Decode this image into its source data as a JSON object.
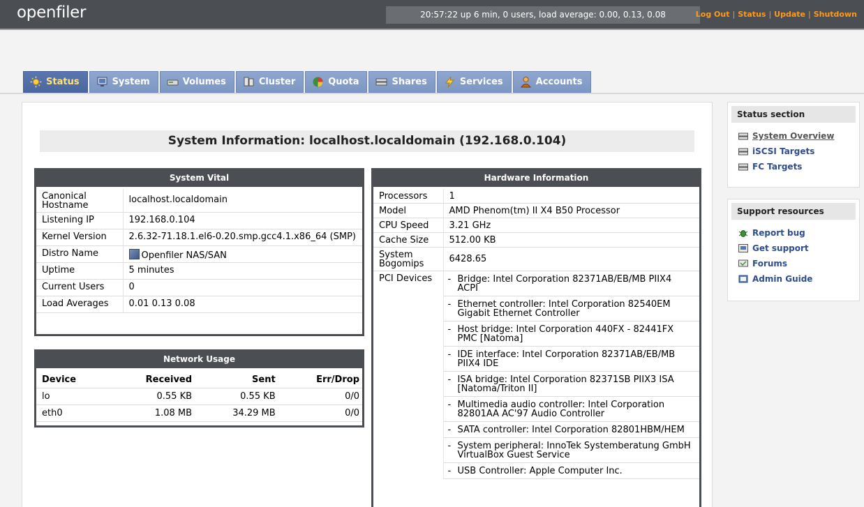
{
  "header": {
    "logo": "openfiler",
    "uptime": "20:57:22 up 6 min, 0 users, load average: 0.00, 0.13, 0.08",
    "links": [
      "Log Out",
      "Status",
      "Update",
      "Shutdown"
    ]
  },
  "tabs": [
    {
      "label": "Status",
      "icon": "sun-icon",
      "active": true
    },
    {
      "label": "System",
      "icon": "monitor-icon"
    },
    {
      "label": "Volumes",
      "icon": "disk-icon"
    },
    {
      "label": "Cluster",
      "icon": "cluster-icon"
    },
    {
      "label": "Quota",
      "icon": "pie-chart-icon"
    },
    {
      "label": "Shares",
      "icon": "server-icon"
    },
    {
      "label": "Services",
      "icon": "lightning-icon"
    },
    {
      "label": "Accounts",
      "icon": "user-icon"
    }
  ],
  "title": "System Information: localhost.localdomain (192.168.0.104)",
  "vital": {
    "heading": "System Vital",
    "rows": [
      {
        "k": "Canonical Hostname",
        "v": "localhost.localdomain"
      },
      {
        "k": "Listening IP",
        "v": "192.168.0.104"
      },
      {
        "k": "Kernel Version",
        "v": "2.6.32-71.18.1.el6-0.20.smp.gcc4.1.x86_64 (SMP)"
      },
      {
        "k": "Distro Name",
        "v": "Openfiler NAS/SAN"
      },
      {
        "k": "Uptime",
        "v": "5 minutes"
      },
      {
        "k": "Current Users",
        "v": "0"
      },
      {
        "k": "Load Averages",
        "v": "0.01 0.13 0.08"
      }
    ]
  },
  "network": {
    "heading": "Network Usage",
    "columns": [
      "Device",
      "Received",
      "Sent",
      "Err/Drop"
    ],
    "rows": [
      [
        "lo",
        "0.55 KB",
        "0.55 KB",
        "0/0"
      ],
      [
        "eth0",
        "1.08 MB",
        "34.29 MB",
        "0/0"
      ]
    ]
  },
  "hardware": {
    "heading": "Hardware Information",
    "rows": [
      {
        "k": "Processors",
        "v": "1"
      },
      {
        "k": "Model",
        "v": "AMD Phenom(tm) II X4 B50 Processor"
      },
      {
        "k": "CPU Speed",
        "v": "3.21 GHz"
      },
      {
        "k": "Cache Size",
        "v": "512.00 KB"
      },
      {
        "k": "System Bogomips",
        "v": "6428.65"
      }
    ],
    "pci_label": "PCI Devices",
    "pci": [
      "Bridge: Intel Corporation 82371AB/EB/MB PIIX4 ACPI",
      "Ethernet controller: Intel Corporation 82540EM Gigabit Ethernet Controller",
      "Host bridge: Intel Corporation 440FX - 82441FX PMC [Natoma]",
      "IDE interface: Intel Corporation 82371AB/EB/MB PIIX4 IDE",
      "ISA bridge: Intel Corporation 82371SB PIIX3 ISA [Natoma/Triton II]",
      "Multimedia audio controller: Intel Corporation 82801AA AC'97 Audio Controller",
      "SATA controller: Intel Corporation 82801HBM/HEM",
      "System peripheral: InnoTek Systemberatung GmbH VirtualBox Guest Service",
      "USB Controller: Apple Computer Inc."
    ]
  },
  "sidebar": {
    "status": {
      "heading": "Status section",
      "items": [
        "System Overview",
        "iSCSI Targets",
        "FC Targets"
      ]
    },
    "support": {
      "heading": "Support resources",
      "items": [
        {
          "label": "Report bug",
          "icon": "bug-icon"
        },
        {
          "label": "Get support",
          "icon": "support-icon"
        },
        {
          "label": "Forums",
          "icon": "forum-icon"
        },
        {
          "label": "Admin Guide",
          "icon": "book-icon"
        }
      ]
    }
  },
  "colors": {
    "header_bg": "#4b4f54",
    "link_orange": "#ff9a1a",
    "tab_blue": "#7d96c3",
    "tab_active": "#4c67a0",
    "sidebar_link": "#2e4d8f"
  }
}
